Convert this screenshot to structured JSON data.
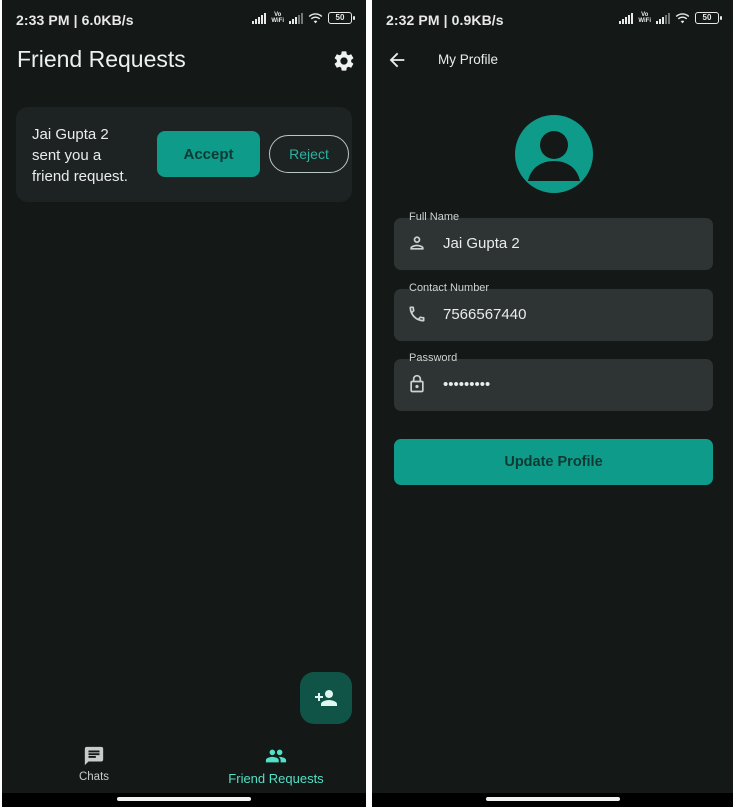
{
  "screens": {
    "left": {
      "status": {
        "time_speed": "2:33 PM | 6.0KB/s",
        "battery": "50",
        "vowifi_top": "Vo",
        "vowifi_bottom": "WiFi"
      },
      "title": "Friend Requests",
      "settings_icon": "gear-icon",
      "request": {
        "message": "Jai Gupta 2 sent you a friend request.",
        "accept_label": "Accept",
        "reject_label": "Reject"
      },
      "fab_icon": "person-add-icon",
      "nav": {
        "chats_label": "Chats",
        "friend_requests_label": "Friend Requests"
      }
    },
    "right": {
      "status": {
        "time_speed": "2:32 PM | 0.9KB/s",
        "battery": "50",
        "vowifi_top": "Vo",
        "vowifi_bottom": "WiFi"
      },
      "title": "My Profile",
      "back_icon": "arrow-back-icon",
      "avatar_icon": "person-circle-icon",
      "fields": {
        "full_name": {
          "label": "Full Name",
          "value": "Jai Gupta 2"
        },
        "contact": {
          "label": "Contact Number",
          "value": "7566567440"
        },
        "password": {
          "label": "Password",
          "value": "•••••••••"
        }
      },
      "update_label": "Update Profile"
    }
  },
  "colors": {
    "background": "#141817",
    "card": "#1d2322",
    "field": "#2e3433",
    "accent": "#0f9b8a",
    "accent_text": "#2bb2a0",
    "active_nav": "#52e0c6",
    "fab": "#0f5447"
  }
}
